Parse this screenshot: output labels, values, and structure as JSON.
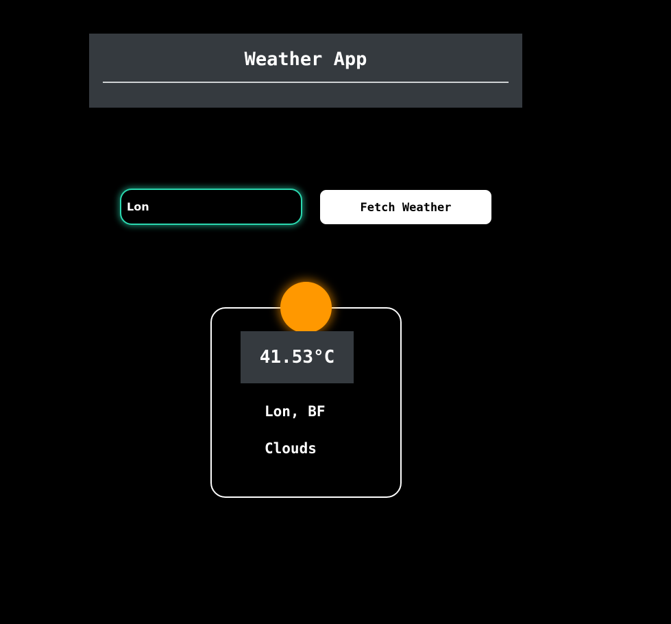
{
  "header": {
    "title": "Weather App"
  },
  "search": {
    "value": "Lon",
    "button_label": "Fetch Weather"
  },
  "weather": {
    "icon": "sun-icon",
    "temperature": "41.53°C",
    "location": "Lon, BF",
    "condition": "Clouds"
  },
  "colors": {
    "background": "#000000",
    "header_bg": "#353a3f",
    "input_glow": "#2bd9b0",
    "sun": "#ff9800",
    "button_bg": "#ffffff"
  }
}
